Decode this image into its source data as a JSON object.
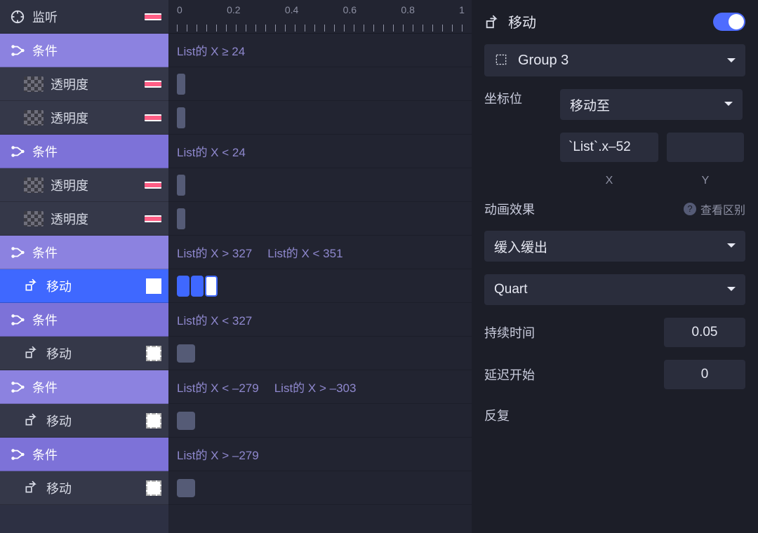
{
  "sidebar": {
    "header_label": "监听",
    "rows": [
      {
        "kind": "cond",
        "name": "sidebar-cond-1",
        "label": "条件",
        "variant": "light"
      },
      {
        "kind": "child",
        "name": "sidebar-opacity-1",
        "label": "透明度",
        "type": "opacity"
      },
      {
        "kind": "child",
        "name": "sidebar-opacity-2",
        "label": "透明度",
        "type": "opacity"
      },
      {
        "kind": "cond",
        "name": "sidebar-cond-2",
        "label": "条件",
        "variant": "dark"
      },
      {
        "kind": "child",
        "name": "sidebar-opacity-3",
        "label": "透明度",
        "type": "opacity"
      },
      {
        "kind": "child",
        "name": "sidebar-opacity-4",
        "label": "透明度",
        "type": "opacity"
      },
      {
        "kind": "cond",
        "name": "sidebar-cond-3",
        "label": "条件",
        "variant": "light"
      },
      {
        "kind": "child",
        "name": "sidebar-move-1",
        "label": "移动",
        "type": "move",
        "selected": true
      },
      {
        "kind": "cond",
        "name": "sidebar-cond-4",
        "label": "条件",
        "variant": "dark"
      },
      {
        "kind": "child",
        "name": "sidebar-move-2",
        "label": "移动",
        "type": "move"
      },
      {
        "kind": "cond",
        "name": "sidebar-cond-5",
        "label": "条件",
        "variant": "light"
      },
      {
        "kind": "child",
        "name": "sidebar-move-3",
        "label": "移动",
        "type": "move"
      },
      {
        "kind": "cond",
        "name": "sidebar-cond-6",
        "label": "条件",
        "variant": "dark"
      },
      {
        "kind": "child",
        "name": "sidebar-move-4",
        "label": "移动",
        "type": "move"
      }
    ]
  },
  "timeline": {
    "ruler": [
      "0",
      "0.2",
      "0.4",
      "0.6",
      "0.8",
      "1"
    ],
    "rows": [
      {
        "text": "List的 X ≥ 24",
        "name": "tl-cond-1"
      },
      {
        "handle": true,
        "name": "tl-handle-1"
      },
      {
        "handle": true,
        "name": "tl-handle-2"
      },
      {
        "text": "List的 X < 24",
        "name": "tl-cond-2"
      },
      {
        "handle": true,
        "name": "tl-handle-3"
      },
      {
        "handle": true,
        "name": "tl-handle-4"
      },
      {
        "text": "List的 X > 327",
        "text2": "List的 X < 351",
        "name": "tl-cond-3"
      },
      {
        "twin": true,
        "name": "tl-handle-5"
      },
      {
        "text": "List的 X < 327",
        "name": "tl-cond-4"
      },
      {
        "smallbox": true,
        "name": "tl-handle-6"
      },
      {
        "text": "List的 X < –279",
        "text2": "List的 X > –303",
        "name": "tl-cond-5"
      },
      {
        "smallbox": true,
        "name": "tl-handle-7"
      },
      {
        "text": "List的 X > –279",
        "name": "tl-cond-6"
      },
      {
        "smallbox": true,
        "name": "tl-handle-8"
      }
    ]
  },
  "inspector": {
    "title": "移动",
    "target_select": "Group 3",
    "coord_label": "坐标位",
    "coord_mode": "移动至",
    "x_value": "`List`.x–52",
    "y_value": "",
    "x_axis": "X",
    "y_axis": "Y",
    "anim_section": "动画效果",
    "anim_hint": "查看区别",
    "easing": "缓入缓出",
    "curve": "Quart",
    "duration_label": "持续时间",
    "duration_value": "0.05",
    "delay_label": "延迟开始",
    "delay_value": "0",
    "repeat_label": "反复"
  }
}
